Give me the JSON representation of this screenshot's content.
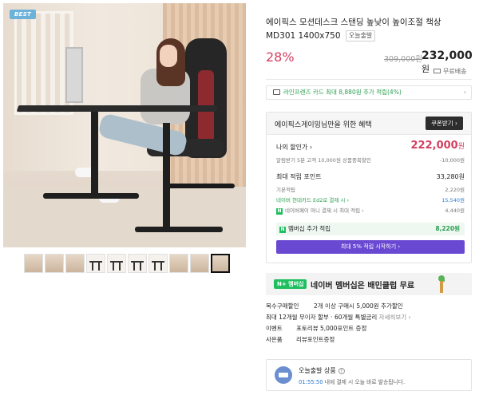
{
  "image": {
    "badge": "BEST"
  },
  "thumbnails": [
    {
      "kind": "photo"
    },
    {
      "kind": "photo"
    },
    {
      "kind": "photo"
    },
    {
      "kind": "desk"
    },
    {
      "kind": "desk"
    },
    {
      "kind": "desk"
    },
    {
      "kind": "desk"
    },
    {
      "kind": "photo"
    },
    {
      "kind": "photo"
    },
    {
      "kind": "photo",
      "active": true
    }
  ],
  "product": {
    "title": "에이픽스 모션데스크 스탠딩 높낮이 높이조절 책상 MD301 1400x750",
    "today_tag": "오늘출발",
    "discount": "28%",
    "original_price": "309,000원",
    "price_number": "232,000",
    "price_unit": "원",
    "shipping": "무료배송"
  },
  "card_banner": {
    "text": "라인프렌즈 카드 최대 8,880원 추가 적립(4%)",
    "chevron": "›"
  },
  "benefit": {
    "heading": "에이픽스게이밍님만을 위한 혜택",
    "coupon_button": "쿠폰받기 ›",
    "my_discount_label": "나의 할인가 ›",
    "my_discount_value": "222,000",
    "my_discount_unit": "원",
    "alert_label": "알림받기 5분 고객 10,000원 상품중복할인",
    "alert_value": "-10,000원",
    "max_points_label": "최대 적립 포인트",
    "max_points_value": "33,280원",
    "basic_label": "기본적립",
    "basic_value": "2,220원",
    "hyundai_label": "네이버 현대카드 Ed2로 결제 시 ›",
    "hyundai_value": "15,540원",
    "npay_label": "네이버페이 머니 결제 시 최대 적립 ›",
    "npay_value": "4,440원",
    "membership_label": "멤버십 추가 적립",
    "membership_value": "8,220원",
    "membership_button": "최대 5% 적립 시작하기 ›"
  },
  "promo": {
    "badge": "N+ 멤버십",
    "text": "네이버 멤버십은 배민클럽 무료"
  },
  "info": {
    "bulk_label": "복수구매할인",
    "bulk_value": "2개 이상 구매시 5,000원 추가할인",
    "installment_text": "최대 12개월 무이자 할부 · 60개월 특별금리",
    "installment_link": "자세히보기 ›",
    "event_label": "이벤트",
    "event_value": "포토리뷰 5,000포인트 증정",
    "gift_label": "사은품",
    "gift_value": "리뷰포인트증정"
  },
  "delivery": {
    "title": "오늘출발 상품",
    "q": "?",
    "time": "01:55:50",
    "subtitle_rest": " 내에 결제 시 오늘 바로 발송됩니다."
  }
}
